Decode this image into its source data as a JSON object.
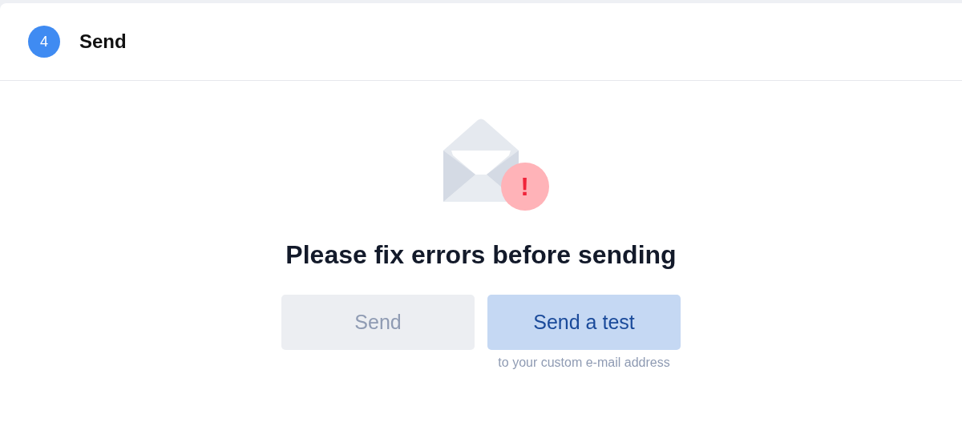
{
  "step": {
    "number": "4",
    "title": "Send"
  },
  "message": "Please fix errors before sending",
  "badge": {
    "symbol": "!"
  },
  "buttons": [
    {
      "label": "Send",
      "kind": "neutral",
      "disabled": true
    },
    {
      "label": "Send a test",
      "kind": "accent",
      "disabled": true,
      "note": "to your custom e-mail address"
    }
  ]
}
